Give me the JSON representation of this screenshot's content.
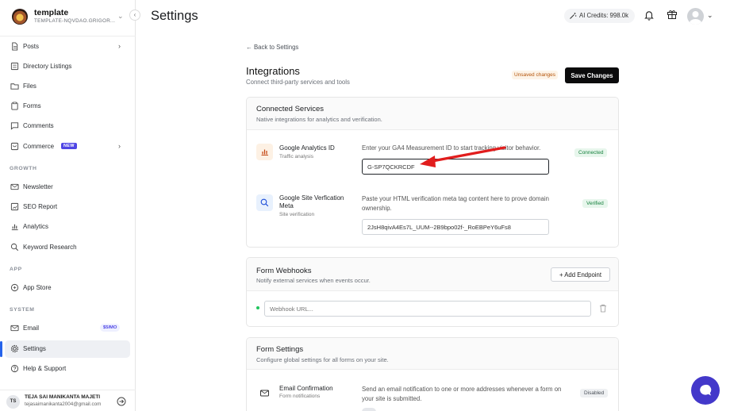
{
  "workspace": {
    "name": "template",
    "subdomain": "TEMPLATE-NQVDAO.GRIGOR..."
  },
  "sidebar": {
    "items_main": [
      {
        "label": "Posts",
        "icon": "document-icon",
        "has_chevron": true
      },
      {
        "label": "Directory Listings",
        "icon": "list-icon"
      },
      {
        "label": "Files",
        "icon": "folder-icon"
      },
      {
        "label": "Forms",
        "icon": "clipboard-icon"
      },
      {
        "label": "Comments",
        "icon": "chat-icon"
      },
      {
        "label": "Commerce",
        "icon": "cart-icon",
        "badge": "NEW",
        "has_chevron": true
      }
    ],
    "section_growth": "GROWTH",
    "items_growth": [
      {
        "label": "Newsletter",
        "icon": "mail-icon"
      },
      {
        "label": "SEO Report",
        "icon": "report-icon"
      },
      {
        "label": "Analytics",
        "icon": "bar-chart-icon"
      },
      {
        "label": "Keyword Research",
        "icon": "search-icon"
      }
    ],
    "section_app": "APP",
    "items_app": [
      {
        "label": "App Store",
        "icon": "store-icon"
      }
    ],
    "section_system": "SYSTEM",
    "items_system": [
      {
        "label": "Email",
        "icon": "mail-icon",
        "badge": "$5/MO"
      },
      {
        "label": "Settings",
        "icon": "gear-icon",
        "active": true
      },
      {
        "label": "Help & Support",
        "icon": "help-icon"
      }
    ]
  },
  "user": {
    "initials": "TS",
    "name": "TEJA SAI MANIKANTA MAJETI",
    "email": "tejasaimanikanta2004@gmail.com"
  },
  "header": {
    "title": "Settings",
    "credits": "AI Credits: 998.0k"
  },
  "main": {
    "back_link": "← Back to Settings",
    "title": "Integrations",
    "subtitle": "Connect third-party services and tools",
    "unsaved": "Unsaved changes",
    "save_label": "Save Changes",
    "connected": {
      "title": "Connected Services",
      "desc": "Native integrations for analytics and verification.",
      "services": [
        {
          "name": "Google Analytics ID",
          "sub": "Traffic analysis",
          "help": "Enter your GA4 Measurement ID to start tracking visitor behavior.",
          "value": "G-SP7QCKRCDF",
          "status": "Connected"
        },
        {
          "name": "Google Site Verfication Meta",
          "sub": "Site verification",
          "help": "Paste your HTML verification meta tag content here to prove domain ownership.",
          "value": "2JsH8qivA4Es7L_UUM--2B9bpo02f-_RoEBPeY6uFs8",
          "status": "Verified"
        }
      ]
    },
    "webhooks": {
      "title": "Form Webhooks",
      "desc": "Notify external services when events occur.",
      "add_label": "+ Add Endpoint",
      "placeholder": "Webhook URL..."
    },
    "form_settings": {
      "title": "Form Settings",
      "desc": "Configure global settings for all forms on your site.",
      "email_confirmation": {
        "name": "Email Confirmation",
        "sub": "Form notifications",
        "help": "Send an email notification to one or more addresses whenever a form on your site is submitted.",
        "status": "Disabled"
      }
    }
  },
  "colors": {
    "accent": "#2563eb",
    "save_button": "#0b0b0c",
    "chat_fab": "#4338ca",
    "annotation_arrow": "#e11d1d",
    "connected_green": "#15803d"
  }
}
